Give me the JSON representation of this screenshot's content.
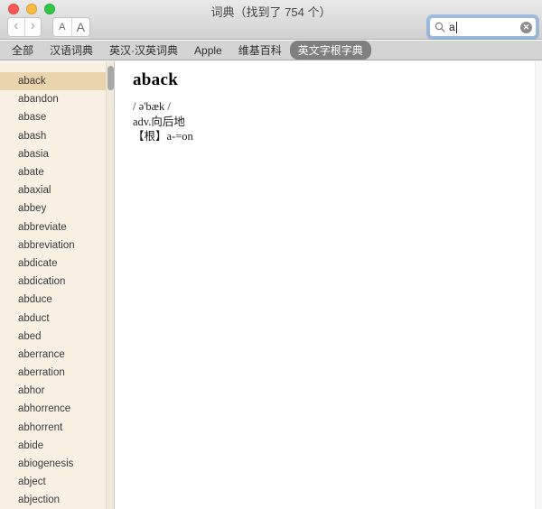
{
  "window": {
    "title": "词典（找到了 754 个）"
  },
  "titlebar": {
    "traffic_lights": [
      {
        "name": "close",
        "color": "#fc5753"
      },
      {
        "name": "minimize",
        "color": "#fdbc40"
      },
      {
        "name": "zoom",
        "color": "#33c748"
      }
    ]
  },
  "toolbar": {
    "back_icon": "‹",
    "forward_icon": "›",
    "font_smaller_label": "A",
    "font_larger_label": "A",
    "search": {
      "value": "a",
      "clear_icon": "✕"
    }
  },
  "tabbar": {
    "selected_bg": "#7f7f7f",
    "tabs": [
      {
        "label": "全部",
        "selected": false
      },
      {
        "label": "汉语词典",
        "selected": false
      },
      {
        "label": "英汉·汉英词典",
        "selected": false
      },
      {
        "label": "Apple",
        "selected": false
      },
      {
        "label": "维基百科",
        "selected": false
      },
      {
        "label": "英文字根字典",
        "selected": true
      }
    ]
  },
  "sidebar": {
    "background": "#f8f1e3",
    "selected_color": "#e9d4ab",
    "selected_index": 0,
    "items": [
      "aback",
      "abandon",
      "abase",
      "abash",
      "abasia",
      "abate",
      "abaxial",
      "abbey",
      "abbreviate",
      "abbreviation",
      "abdicate",
      "abdication",
      "abduce",
      "abduct",
      "abed",
      "aberrance",
      "aberration",
      "abhor",
      "abhorrence",
      "abhorrent",
      "abide",
      "abiogenesis",
      "abject",
      "abjection"
    ]
  },
  "entry": {
    "headword": "aback",
    "phonetic": "/ ə'bæk /",
    "definition": "adv.向后地",
    "root": "【根】a-=on"
  }
}
